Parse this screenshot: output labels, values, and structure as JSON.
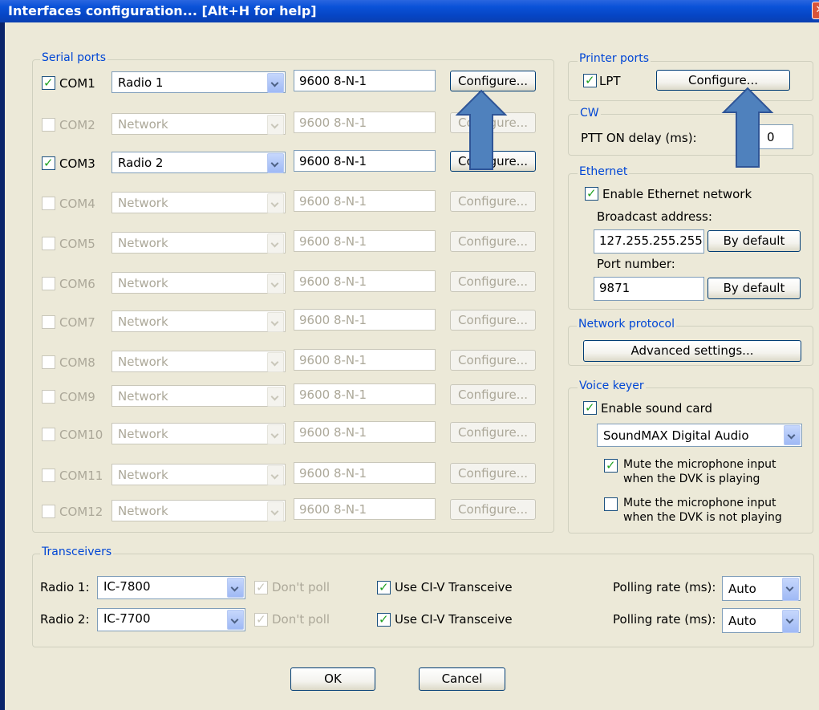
{
  "window": {
    "title": "Interfaces configuration... [Alt+H for help]",
    "close_glyph": "✕"
  },
  "serial": {
    "title": "Serial ports",
    "rows": [
      {
        "port": "COM1",
        "checked": true,
        "device": "Radio 1",
        "params": "9600 8-N-1",
        "button": "Configure...",
        "enabled": true
      },
      {
        "port": "COM2",
        "checked": false,
        "device": "Network",
        "params": "9600 8-N-1",
        "button": "Configure...",
        "enabled": false
      },
      {
        "port": "COM3",
        "checked": true,
        "device": "Radio 2",
        "params": "9600 8-N-1",
        "button": "Configure...",
        "enabled": true
      },
      {
        "port": "COM4",
        "checked": false,
        "device": "Network",
        "params": "9600 8-N-1",
        "button": "Configure...",
        "enabled": false
      },
      {
        "port": "COM5",
        "checked": false,
        "device": "Network",
        "params": "9600 8-N-1",
        "button": "Configure...",
        "enabled": false
      },
      {
        "port": "COM6",
        "checked": false,
        "device": "Network",
        "params": "9600 8-N-1",
        "button": "Configure...",
        "enabled": false
      },
      {
        "port": "COM7",
        "checked": false,
        "device": "Network",
        "params": "9600 8-N-1",
        "button": "Configure...",
        "enabled": false
      },
      {
        "port": "COM8",
        "checked": false,
        "device": "Network",
        "params": "9600 8-N-1",
        "button": "Configure...",
        "enabled": false
      },
      {
        "port": "COM9",
        "checked": false,
        "device": "Network",
        "params": "9600 8-N-1",
        "button": "Configure...",
        "enabled": false
      },
      {
        "port": "COM10",
        "checked": false,
        "device": "Network",
        "params": "9600 8-N-1",
        "button": "Configure...",
        "enabled": false
      },
      {
        "port": "COM11",
        "checked": false,
        "device": "Network",
        "params": "9600 8-N-1",
        "button": "Configure...",
        "enabled": false
      },
      {
        "port": "COM12",
        "checked": false,
        "device": "Network",
        "params": "9600 8-N-1",
        "button": "Configure...",
        "enabled": false
      }
    ]
  },
  "printer": {
    "title": "Printer ports",
    "lpt_label": "LPT",
    "lpt_checked": true,
    "configure": "Configure..."
  },
  "cw": {
    "title": "CW",
    "ptt_label": "PTT ON delay (ms):",
    "ptt_value": "0"
  },
  "ethernet": {
    "title": "Ethernet",
    "enable_label": "Enable Ethernet network",
    "broadcast_label": "Broadcast address:",
    "broadcast_value": "127.255.255.255",
    "by_default": "By default",
    "port_label": "Port number:",
    "port_value": "9871"
  },
  "network_protocol": {
    "title": "Network protocol",
    "advanced": "Advanced settings..."
  },
  "voice_keyer": {
    "title": "Voice keyer",
    "enable_label": "Enable sound card",
    "device": "SoundMAX Digital Audio",
    "mute_playing_1": "Mute the microphone input",
    "mute_playing_2": "when the DVK is playing",
    "mute_not_playing_1": "Mute the microphone input",
    "mute_not_playing_2": "when the DVK is not playing"
  },
  "transceivers": {
    "title": "Transceivers",
    "rows": [
      {
        "label": "Radio 1:",
        "model": "IC-7800",
        "dont_poll": "Don't poll",
        "civ": "Use CI-V Transceive",
        "polling_label": "Polling rate (ms):",
        "polling": "Auto"
      },
      {
        "label": "Radio 2:",
        "model": "IC-7700",
        "dont_poll": "Don't poll",
        "civ": "Use CI-V Transceive",
        "polling_label": "Polling rate (ms):",
        "polling": "Auto"
      }
    ]
  },
  "buttons": {
    "ok": "OK",
    "cancel": "Cancel"
  },
  "colors": {
    "arrow_fill": "#4f81bd",
    "arrow_stroke": "#2f5597",
    "titlebar": "#0a52d8",
    "dialog_bg": "#ece9d8"
  }
}
